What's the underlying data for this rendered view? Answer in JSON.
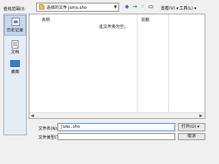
{
  "header": {
    "look_in_label": "查找范围(I):",
    "look_in_value": "选择的文件 jsmu.sho",
    "views_label": "查看(V) ▾",
    "tools_label": "工具(L) ▾"
  },
  "toolbar": {
    "back_glyph": "◆",
    "up_glyph": "➔",
    "delete_glyph": "✕",
    "new_folder_glyph": "▭"
  },
  "places": {
    "history": "历史记录",
    "documents": "文档",
    "desktop": "桌面"
  },
  "file_list": {
    "columns": [
      "名称",
      "日期"
    ],
    "empty_message": "此文件夹为空。"
  },
  "footer": {
    "file_name_label": "文件名(N):",
    "file_name_value": "jsmu.sho",
    "open_label": "打开(O)",
    "file_type_label": "文件类型(T):",
    "file_type_value": "",
    "cancel_label": "取消"
  },
  "colors": {
    "background": "#f0f0f0",
    "accent": "#3a7bd5",
    "desktop_icon": "#2d7fd4"
  }
}
